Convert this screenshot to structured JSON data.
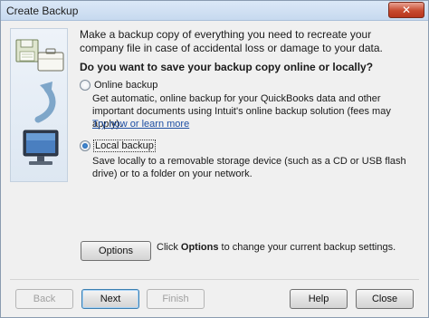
{
  "window": {
    "title": "Create Backup",
    "close_glyph": "✕"
  },
  "intro": {
    "text": "Make a backup copy of everything you need to recreate your company file in case of accidental loss or damage to your data."
  },
  "question": {
    "text": "Do you want to save your backup copy online or locally?"
  },
  "options": {
    "online": {
      "label": "Online backup",
      "selected": false,
      "description": "Get automatic, online backup for your QuickBooks data and other important documents using Intuit's online backup solution (fees may apply).",
      "link": "Try now or learn more"
    },
    "local": {
      "label": "Local backup",
      "selected": true,
      "description": "Save locally to a removable storage device (such as a CD or USB flash drive) or to a folder on your network."
    }
  },
  "options_button": {
    "label": "Options",
    "hint_prefix": "Click ",
    "hint_bold": "Options",
    "hint_suffix": " to change your current backup settings."
  },
  "footer": {
    "back": "Back",
    "next": "Next",
    "finish": "Finish",
    "help": "Help",
    "close": "Close"
  },
  "icons": [
    "floppy-disk-icon",
    "briefcase-icon",
    "curved-arrow-icon",
    "monitor-icon"
  ],
  "colors": {
    "link": "#1e4fa3",
    "title_bar": "#c7d9ef",
    "close_red": "#c74a2f",
    "radio_selected": "#1a5aa8"
  }
}
